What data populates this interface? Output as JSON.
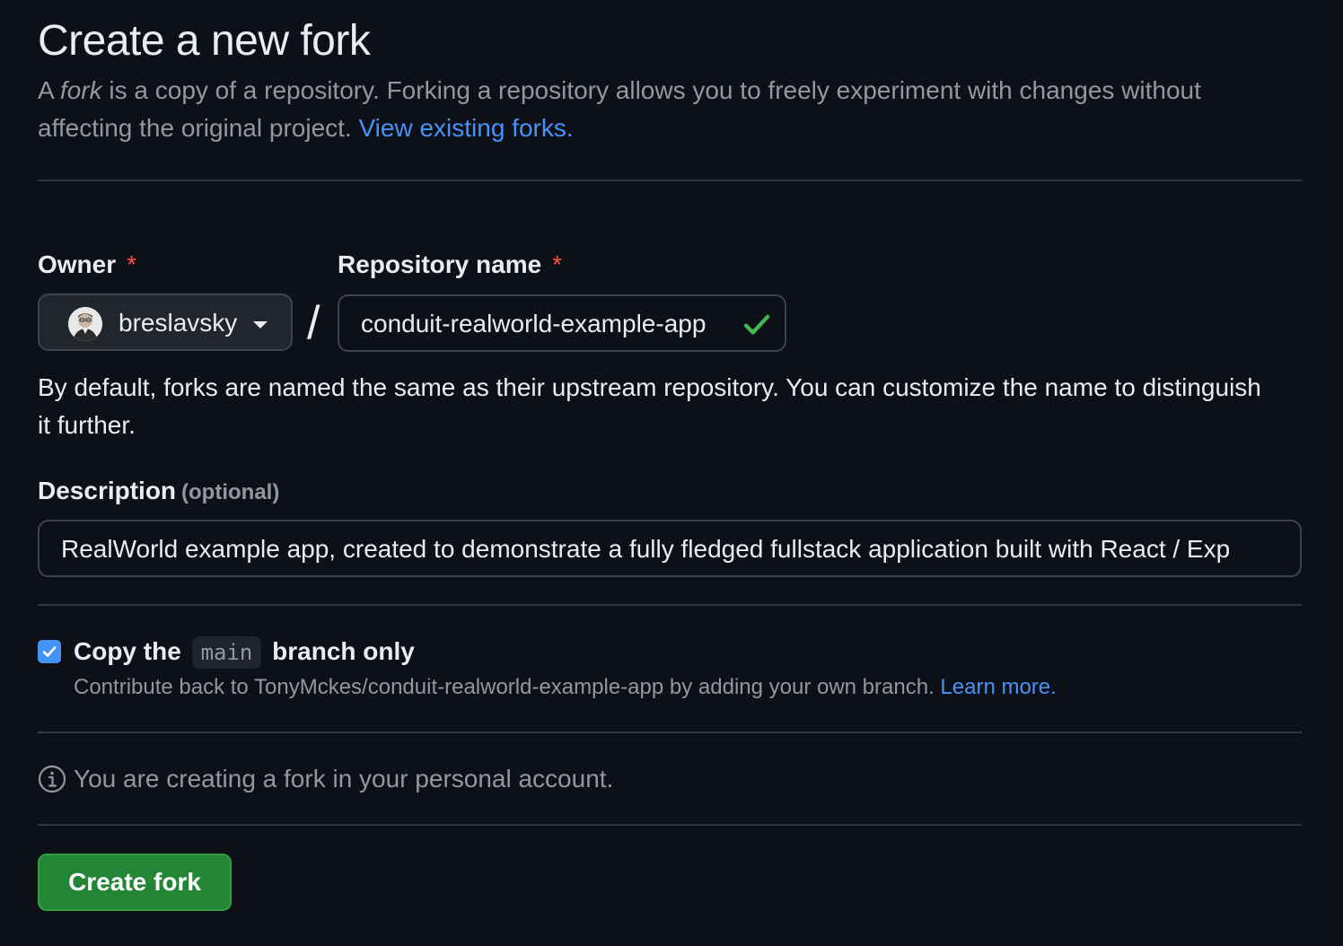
{
  "header": {
    "title": "Create a new fork",
    "intro_prefix": "A ",
    "intro_emphasis": "fork",
    "intro_body": " is a copy of a repository. Forking a repository allows you to freely experiment with changes without affecting the original project. ",
    "view_forks_link": "View existing forks."
  },
  "owner": {
    "label": "Owner",
    "required_mark": "*",
    "selected": "breslavsky"
  },
  "separator": "/",
  "repository": {
    "label": "Repository name",
    "required_mark": "*",
    "value": "conduit-realworld-example-app",
    "valid_icon": "check-icon"
  },
  "naming_help": "By default, forks are named the same as their upstream repository. You can customize the name to distinguish it further.",
  "description": {
    "label": "Description",
    "optional_label": "(optional)",
    "value": "RealWorld example app, created to demonstrate a fully fledged fullstack application built with React / Exp"
  },
  "copy_branch": {
    "checked": true,
    "label_prefix": "Copy the",
    "branch": "main",
    "label_suffix": "branch only",
    "help_text": "Contribute back to TonyMckes/conduit-realworld-example-app by adding your own branch. ",
    "learn_more": "Learn more."
  },
  "notice": {
    "icon": "info-icon",
    "text": "You are creating a fork in your personal account."
  },
  "actions": {
    "create_fork": "Create fork"
  },
  "colors": {
    "background": "#0d1117",
    "link": "#4493f8",
    "primary_button": "#238636",
    "required": "#f85149",
    "success": "#3fb950",
    "checkbox": "#4493f8"
  }
}
